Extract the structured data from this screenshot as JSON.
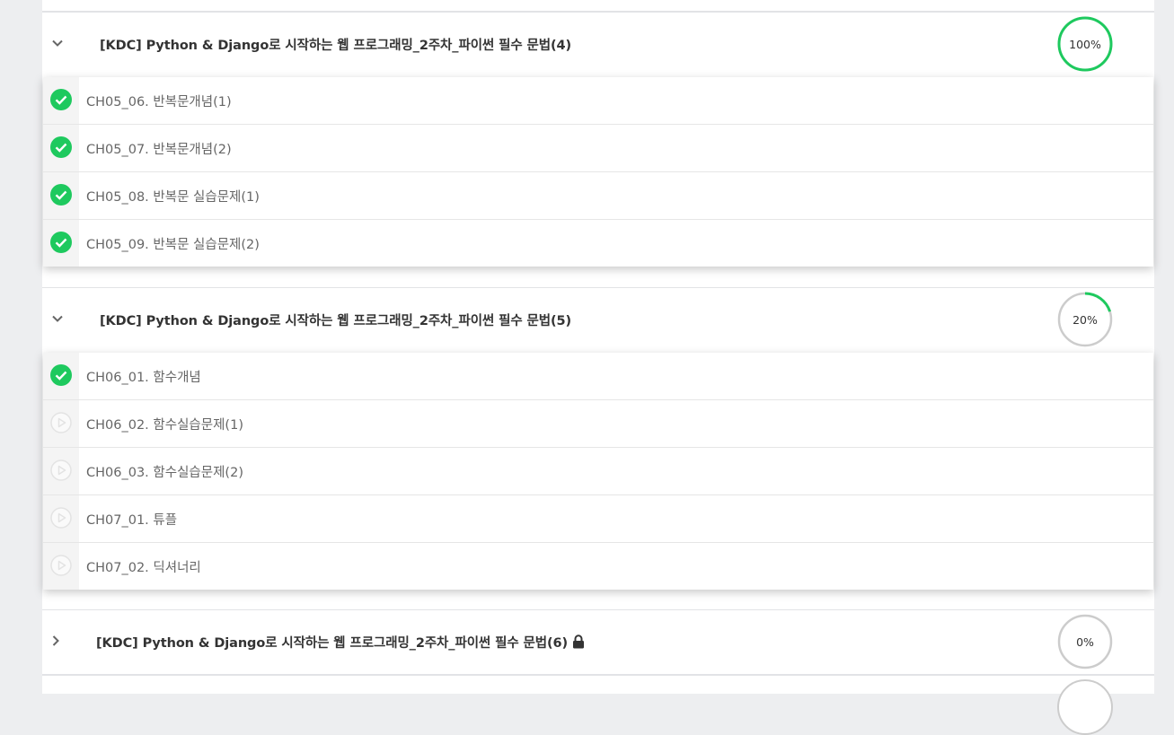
{
  "courses": [
    {
      "title": "[KDC] Python & Django로 시작하는 웹 프로그래밍_2주차_파이썬 필수 문법(4)",
      "progress_label": "100%",
      "progress": 1.0,
      "expanded": true,
      "lessons": [
        {
          "label": "CH05_06. 반복문개념(1)",
          "status": "completed",
          "icon": "check-circle-icon"
        },
        {
          "label": "CH05_07. 반복문개념(2)",
          "status": "completed",
          "icon": "check-circle-icon"
        },
        {
          "label": "CH05_08. 반복문 실습문제(1)",
          "status": "completed",
          "icon": "check-circle-icon"
        },
        {
          "label": "CH05_09. 반복문 실습문제(2)",
          "status": "completed",
          "icon": "check-circle-icon"
        }
      ]
    },
    {
      "title": "[KDC] Python & Django로 시작하는 웹 프로그래밍_2주차_파이썬 필수 문법(5)",
      "progress_label": "20%",
      "progress": 0.2,
      "expanded": true,
      "lessons": [
        {
          "label": "CH06_01. 함수개념",
          "status": "completed",
          "icon": "check-circle-icon"
        },
        {
          "label": "CH06_02. 함수실습문제(1)",
          "status": "not-started",
          "icon": "play-circle-icon"
        },
        {
          "label": "CH06_03. 함수실습문제(2)",
          "status": "not-started",
          "icon": "play-circle-icon"
        },
        {
          "label": "CH07_01. 튜플",
          "status": "not-started",
          "icon": "play-circle-icon"
        },
        {
          "label": "CH07_02. 딕셔너리",
          "status": "not-started",
          "icon": "play-circle-icon"
        }
      ]
    },
    {
      "title": "[KDC] Python & Django로 시작하는 웹 프로그래밍_2주차_파이썬 필수 문법(6)",
      "progress_label": "0%",
      "progress": 0.0,
      "expanded": false,
      "locked": true,
      "lessons": []
    }
  ],
  "colors": {
    "accent": "#1ec95e",
    "ring_track": "#cccccc",
    "background": "#edeef0",
    "inactive_icon": "#e6e6e6"
  },
  "icons": {
    "expanded": "chevron-down-icon",
    "collapsed": "chevron-right-icon",
    "locked": "lock-icon"
  }
}
